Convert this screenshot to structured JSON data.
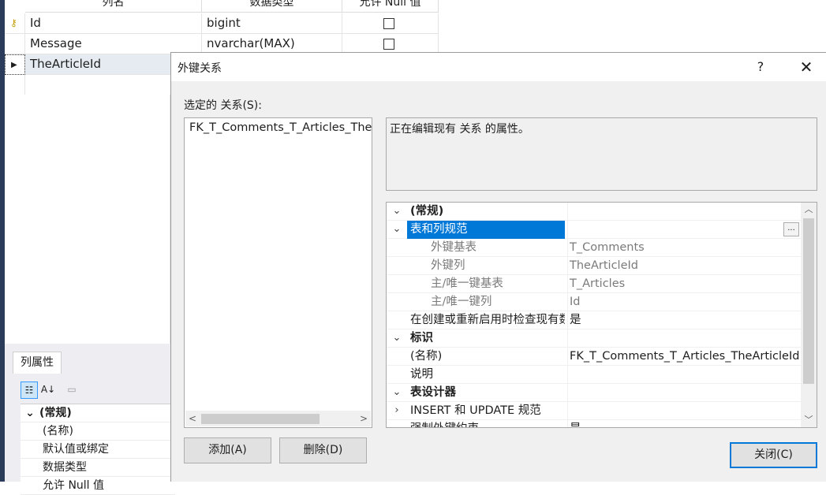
{
  "grid": {
    "headers": [
      "列名",
      "数据类型",
      "允许 Null 值"
    ],
    "rows": [
      {
        "name": "Id",
        "type": "bigint"
      },
      {
        "name": "Message",
        "type": "nvarchar(MAX)"
      },
      {
        "name": "TheArticleId",
        "type": ""
      }
    ]
  },
  "column_properties": {
    "tab_label": "列属性",
    "rows": [
      {
        "name": "(常规)",
        "category": true
      },
      {
        "name": "(名称)"
      },
      {
        "name": "默认值或绑定"
      },
      {
        "name": "数据类型"
      },
      {
        "name": "允许 Null 值"
      }
    ]
  },
  "dialog": {
    "title": "外键关系",
    "help_glyph": "?",
    "close_glyph": "✕",
    "selected_label": "选定的 关系(S):",
    "relations": [
      "FK_T_Comments_T_Articles_TheArticleId"
    ],
    "description": "正在编辑现有 关系 的属性。",
    "properties": [
      {
        "name": "(常规)",
        "value": "",
        "kind": "category",
        "expander": "⌄"
      },
      {
        "name": "表和列规范",
        "value": "",
        "kind": "selected",
        "expander": "⌄"
      },
      {
        "name": "外键基表",
        "value": "T_Comments",
        "kind": "sub"
      },
      {
        "name": "外键列",
        "value": "TheArticleId",
        "kind": "sub"
      },
      {
        "name": "主/唯一键基表",
        "value": "T_Articles",
        "kind": "sub"
      },
      {
        "name": "主/唯一键列",
        "value": "Id",
        "kind": "sub"
      },
      {
        "name": "在创建或重新启用时检查现有数据",
        "value": "是",
        "kind": "plain"
      },
      {
        "name": "标识",
        "value": "",
        "kind": "category",
        "expander": "⌄"
      },
      {
        "name": "(名称)",
        "value": "FK_T_Comments_T_Articles_TheArticleId",
        "kind": "plain"
      },
      {
        "name": "说明",
        "value": "",
        "kind": "plain"
      },
      {
        "name": "表设计器",
        "value": "",
        "kind": "category",
        "expander": "⌄"
      },
      {
        "name": "INSERT 和 UPDATE 规范",
        "value": "",
        "kind": "collapsed",
        "expander": "›"
      },
      {
        "name": "强制外键约束",
        "value": "是",
        "kind": "plain"
      }
    ],
    "add_button": "添加(A)",
    "delete_button": "删除(D)",
    "close_button": "关闭(C)",
    "ellipsis": "..."
  },
  "colors": {
    "selection": "#0078d7",
    "dialog_bg": "#f0f0f0",
    "strip": "#2b3c5a"
  }
}
